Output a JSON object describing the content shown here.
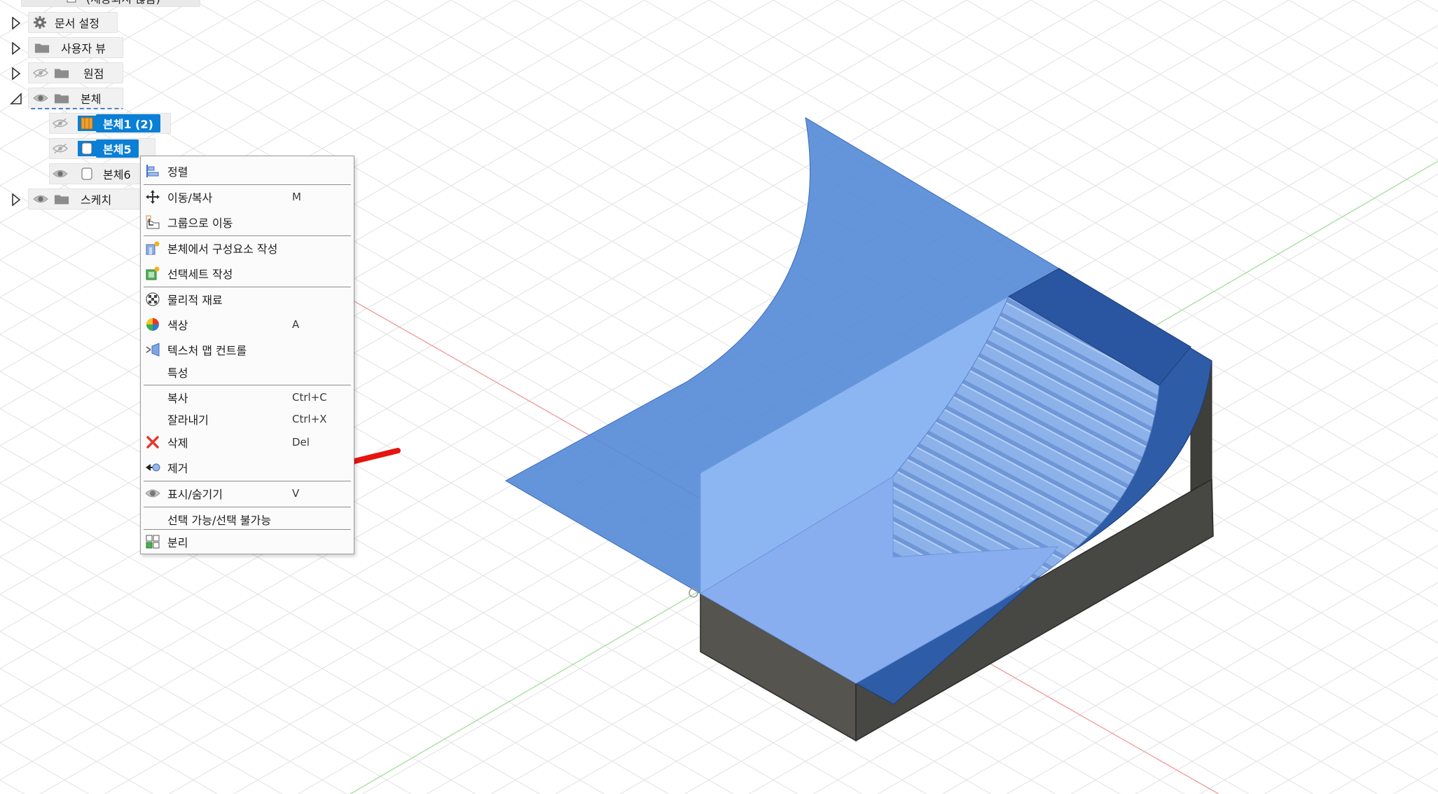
{
  "browser": {
    "top_item": "(제공되지 않음)",
    "items": [
      {
        "label": "문서 설정",
        "icon": "gear-icon"
      },
      {
        "label": "사용자 뷰",
        "icon": "folder-icon"
      },
      {
        "label": "원점",
        "icon": "folder-icon",
        "visibility": "hidden-eye-icon"
      },
      {
        "label": "본체",
        "icon": "folder-icon",
        "visibility": "eye-icon"
      },
      {
        "label": "스케치",
        "icon": "folder-icon",
        "visibility": "eye-icon"
      }
    ],
    "bodies": [
      {
        "label": "본체1 (2)",
        "selected": true,
        "icon": "component-body-icon",
        "visibility": "hidden-eye-icon"
      },
      {
        "label": "본체5",
        "selected": true,
        "icon": "body-icon",
        "visibility": "hidden-eye-icon"
      },
      {
        "label": "본체6",
        "selected": false,
        "icon": "body-icon",
        "visibility": "eye-icon"
      }
    ]
  },
  "context_menu": {
    "items": [
      {
        "label": "정렬",
        "shortcut": "",
        "icon": "align-icon"
      },
      {
        "label": "이동/복사",
        "shortcut": "M",
        "icon": "move-icon"
      },
      {
        "label": "그룹으로 이동",
        "shortcut": "",
        "icon": "move-to-group-icon"
      },
      {
        "label": "본체에서 구성요소 작성",
        "shortcut": "",
        "icon": "create-component-icon"
      },
      {
        "label": "선택세트 작성",
        "shortcut": "",
        "icon": "selection-set-icon"
      },
      {
        "label": "물리적 재료",
        "shortcut": "",
        "icon": "physical-material-icon"
      },
      {
        "label": "색상",
        "shortcut": "A",
        "icon": "appearance-icon"
      },
      {
        "label": "텍스처 맵 컨트롤",
        "shortcut": "",
        "icon": "texture-map-icon"
      },
      {
        "label": "특성",
        "shortcut": "",
        "icon": ""
      },
      {
        "label": "복사",
        "shortcut": "Ctrl+C",
        "icon": ""
      },
      {
        "label": "잘라내기",
        "shortcut": "Ctrl+X",
        "icon": ""
      },
      {
        "label": "삭제",
        "shortcut": "Del",
        "icon": "delete-icon"
      },
      {
        "label": "제거",
        "shortcut": "",
        "icon": "remove-icon"
      },
      {
        "label": "표시/숨기기",
        "shortcut": "V",
        "icon": "eye-icon"
      },
      {
        "label": "선택 가능/선택 불가능",
        "shortcut": "",
        "icon": ""
      },
      {
        "label": "분리",
        "shortcut": "",
        "icon": "split-icon"
      }
    ]
  },
  "colors": {
    "selection_blue": "#0a7fd6",
    "surface_blue": "#4f86d6",
    "annotation_arrow": "#e8140f",
    "solid_body": "#555451"
  }
}
